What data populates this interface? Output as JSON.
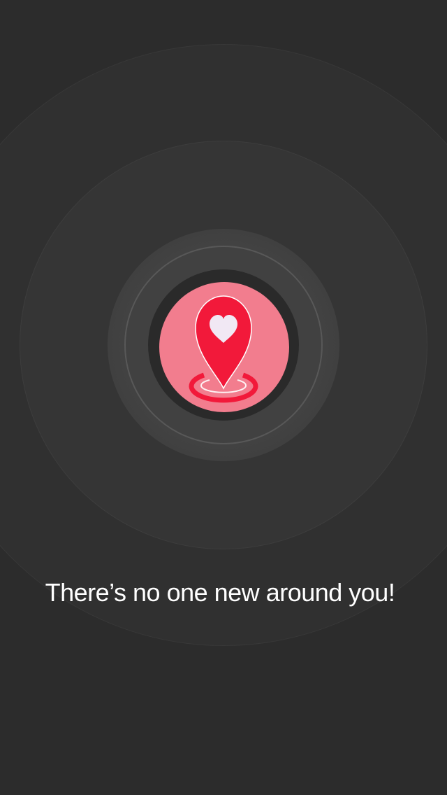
{
  "empty_state": {
    "message": "There’s no one new around you!",
    "icon": "location-heart-pin-icon"
  },
  "colors": {
    "background": "#2c2c2c",
    "icon_circle": "#f27d8e",
    "pin_red": "#f2193a",
    "heart": "#f1e8f4",
    "text": "#ffffff"
  }
}
